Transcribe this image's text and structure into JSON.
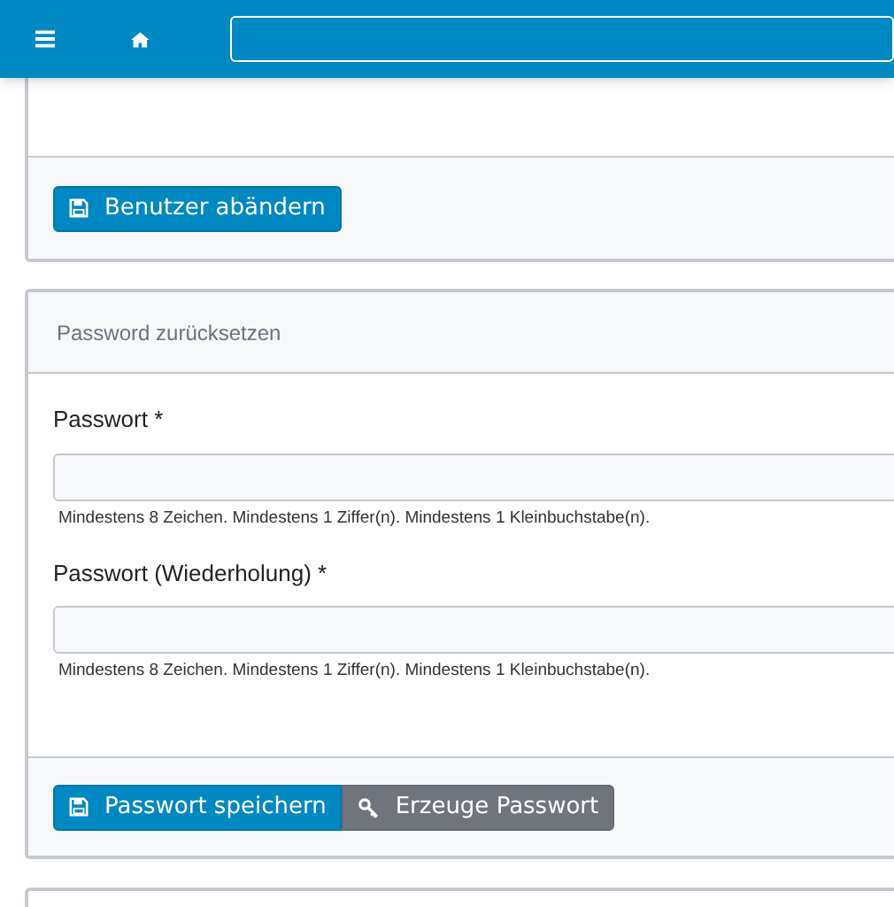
{
  "user_card": {
    "buttons": [
      {
        "label": "Benutzer abändern",
        "kind": "primary"
      }
    ]
  },
  "password_card": {
    "title": "Password zurücksetzen",
    "fields": [
      {
        "label": "Passwort *",
        "help": "Mindestens 8 Zeichen. Mindestens 1 Ziffer(n). Mindestens 1 Kleinbuchstabe(n)."
      },
      {
        "label": "Passwort (Wiederholung) *",
        "help": "Mindestens 8 Zeichen. Mindestens 1 Ziffer(n). Mindestens 1 Kleinbuchstabe(n)."
      }
    ],
    "buttons": [
      {
        "label": "Passwort speichern",
        "kind": "primary"
      },
      {
        "label": "Erzeuge Passwort",
        "kind": "secondary"
      }
    ]
  }
}
